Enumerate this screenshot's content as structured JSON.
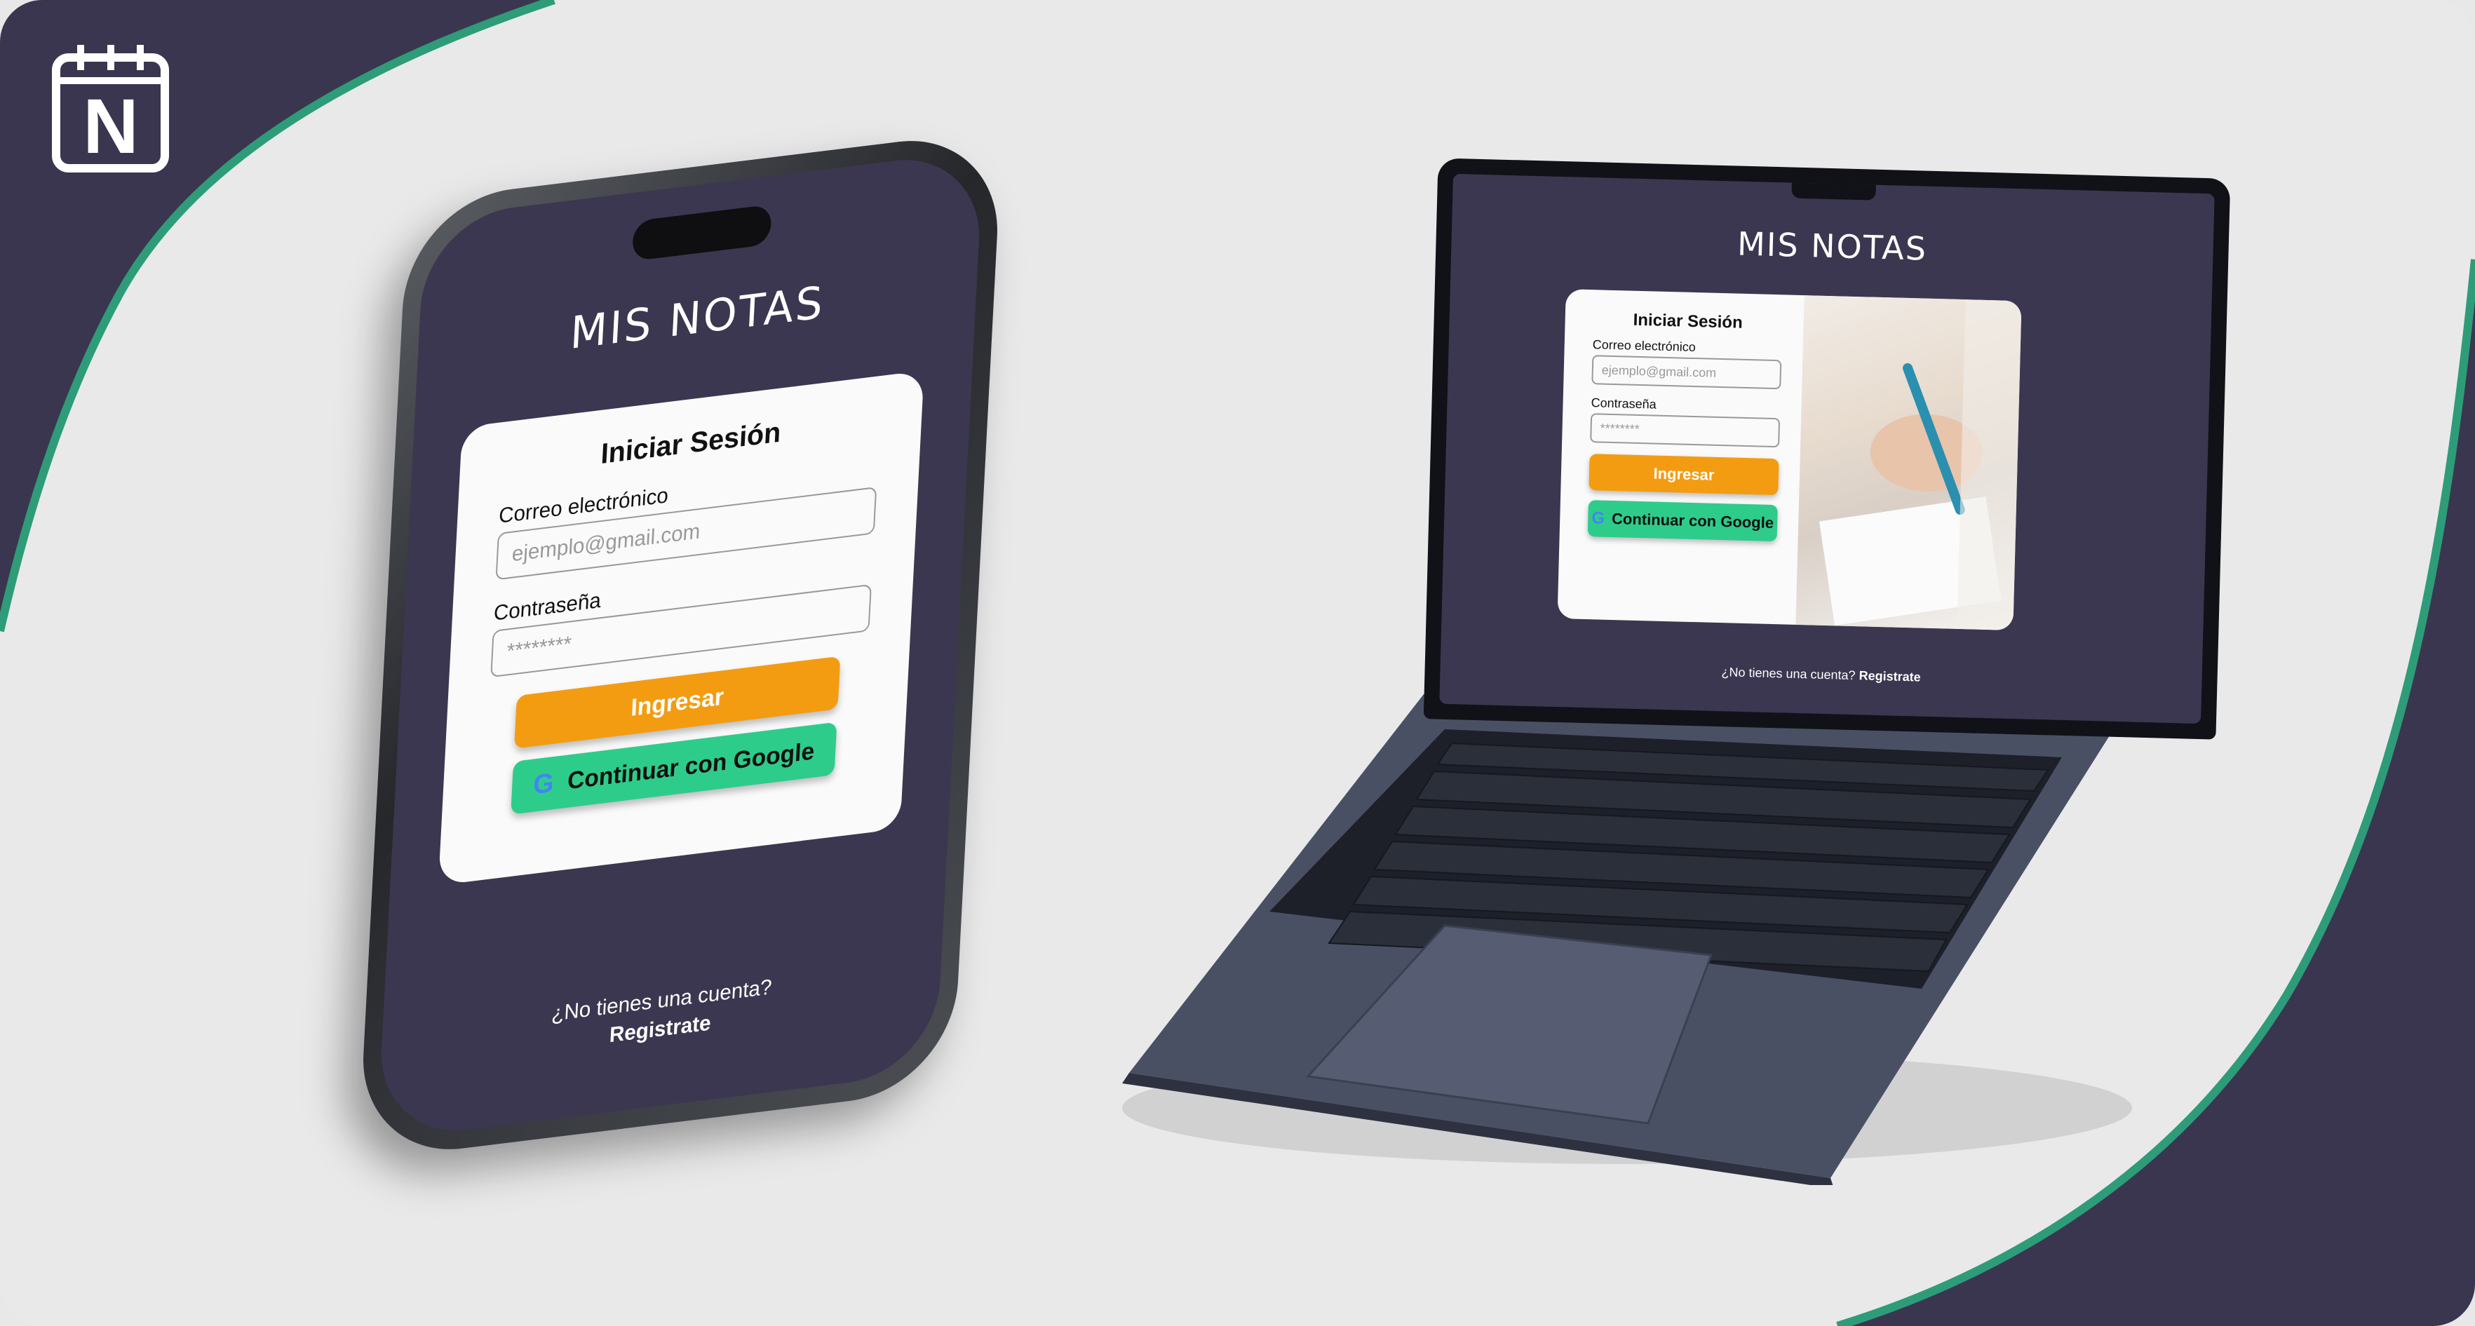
{
  "brand": {
    "logo_icon": "notebook-calendar-icon",
    "logo_letter": "N",
    "accent_color": "#2e9c78",
    "dark_color": "#3a3650"
  },
  "app": {
    "title": "MIS NOTAS"
  },
  "login": {
    "heading": "Iniciar  Sesión",
    "email_label": "Correo electrónico",
    "email_placeholder": "ejemplo@gmail.com",
    "password_label": "Contraseña",
    "password_placeholder": "********",
    "submit_label": "Ingresar",
    "google_label": "Continuar con Google",
    "google_icon": "google-g-icon",
    "footer_question": "¿No tienes una cuenta?",
    "footer_link": "Registrate",
    "submit_color": "#f39c12",
    "google_color": "#2ecc8a"
  }
}
